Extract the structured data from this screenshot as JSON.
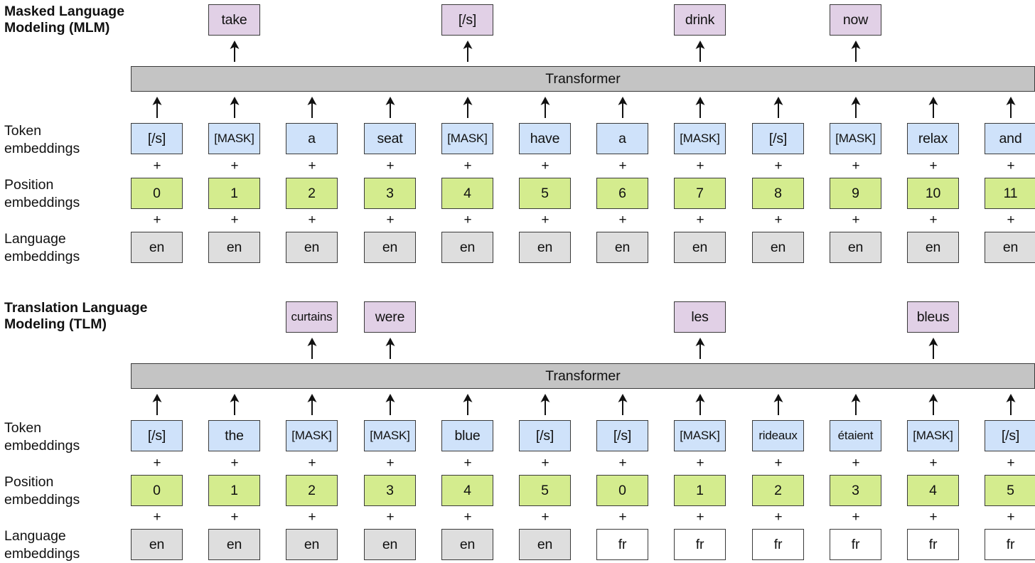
{
  "sections": [
    {
      "id": "mlm",
      "title": "Masked Language\nModeling (MLM)",
      "transformer_label": "Transformer",
      "row_labels": {
        "token": "Token\nembeddings",
        "position": "Position\nembeddings",
        "language": "Language\nembeddings"
      },
      "outputs": [
        {
          "column": 1,
          "text": "take"
        },
        {
          "column": 4,
          "text": "[/s]"
        },
        {
          "column": 7,
          "text": "drink"
        },
        {
          "column": 9,
          "text": "now"
        }
      ],
      "tokens": [
        "[/s]",
        "[MASK]",
        "a",
        "seat",
        "[MASK]",
        "have",
        "a",
        "[MASK]",
        "[/s]",
        "[MASK]",
        "relax",
        "and"
      ],
      "positions": [
        "0",
        "1",
        "2",
        "3",
        "4",
        "5",
        "6",
        "7",
        "8",
        "9",
        "10",
        "11"
      ],
      "languages": [
        "en",
        "en",
        "en",
        "en",
        "en",
        "en",
        "en",
        "en",
        "en",
        "en",
        "en",
        "en"
      ],
      "plus_symbol": "+"
    },
    {
      "id": "tlm",
      "title": "Translation Language\nModeling (TLM)",
      "transformer_label": "Transformer",
      "row_labels": {
        "token": "Token\nembeddings",
        "position": "Position\nembeddings",
        "language": "Language\nembeddings"
      },
      "outputs": [
        {
          "column": 2,
          "text": "curtains"
        },
        {
          "column": 3,
          "text": "were"
        },
        {
          "column": 7,
          "text": "les"
        },
        {
          "column": 10,
          "text": "bleus"
        }
      ],
      "tokens": [
        "[/s]",
        "the",
        "[MASK]",
        "[MASK]",
        "blue",
        "[/s]",
        "[/s]",
        "[MASK]",
        "rideaux",
        "étaient",
        "[MASK]",
        "[/s]"
      ],
      "positions": [
        "0",
        "1",
        "2",
        "3",
        "4",
        "5",
        "0",
        "1",
        "2",
        "3",
        "4",
        "5"
      ],
      "languages": [
        "en",
        "en",
        "en",
        "en",
        "en",
        "en",
        "fr",
        "fr",
        "fr",
        "fr",
        "fr",
        "fr"
      ],
      "plus_symbol": "+"
    }
  ],
  "colors": {
    "output_box": "#e1d0e6",
    "token_box": "#cfe2fa",
    "position_box": "#d4ec8e",
    "language_en_box": "#dedede",
    "language_fr_box": "#ffffff",
    "transformer": "#c4c4c4",
    "border": "#3a3a3a"
  }
}
